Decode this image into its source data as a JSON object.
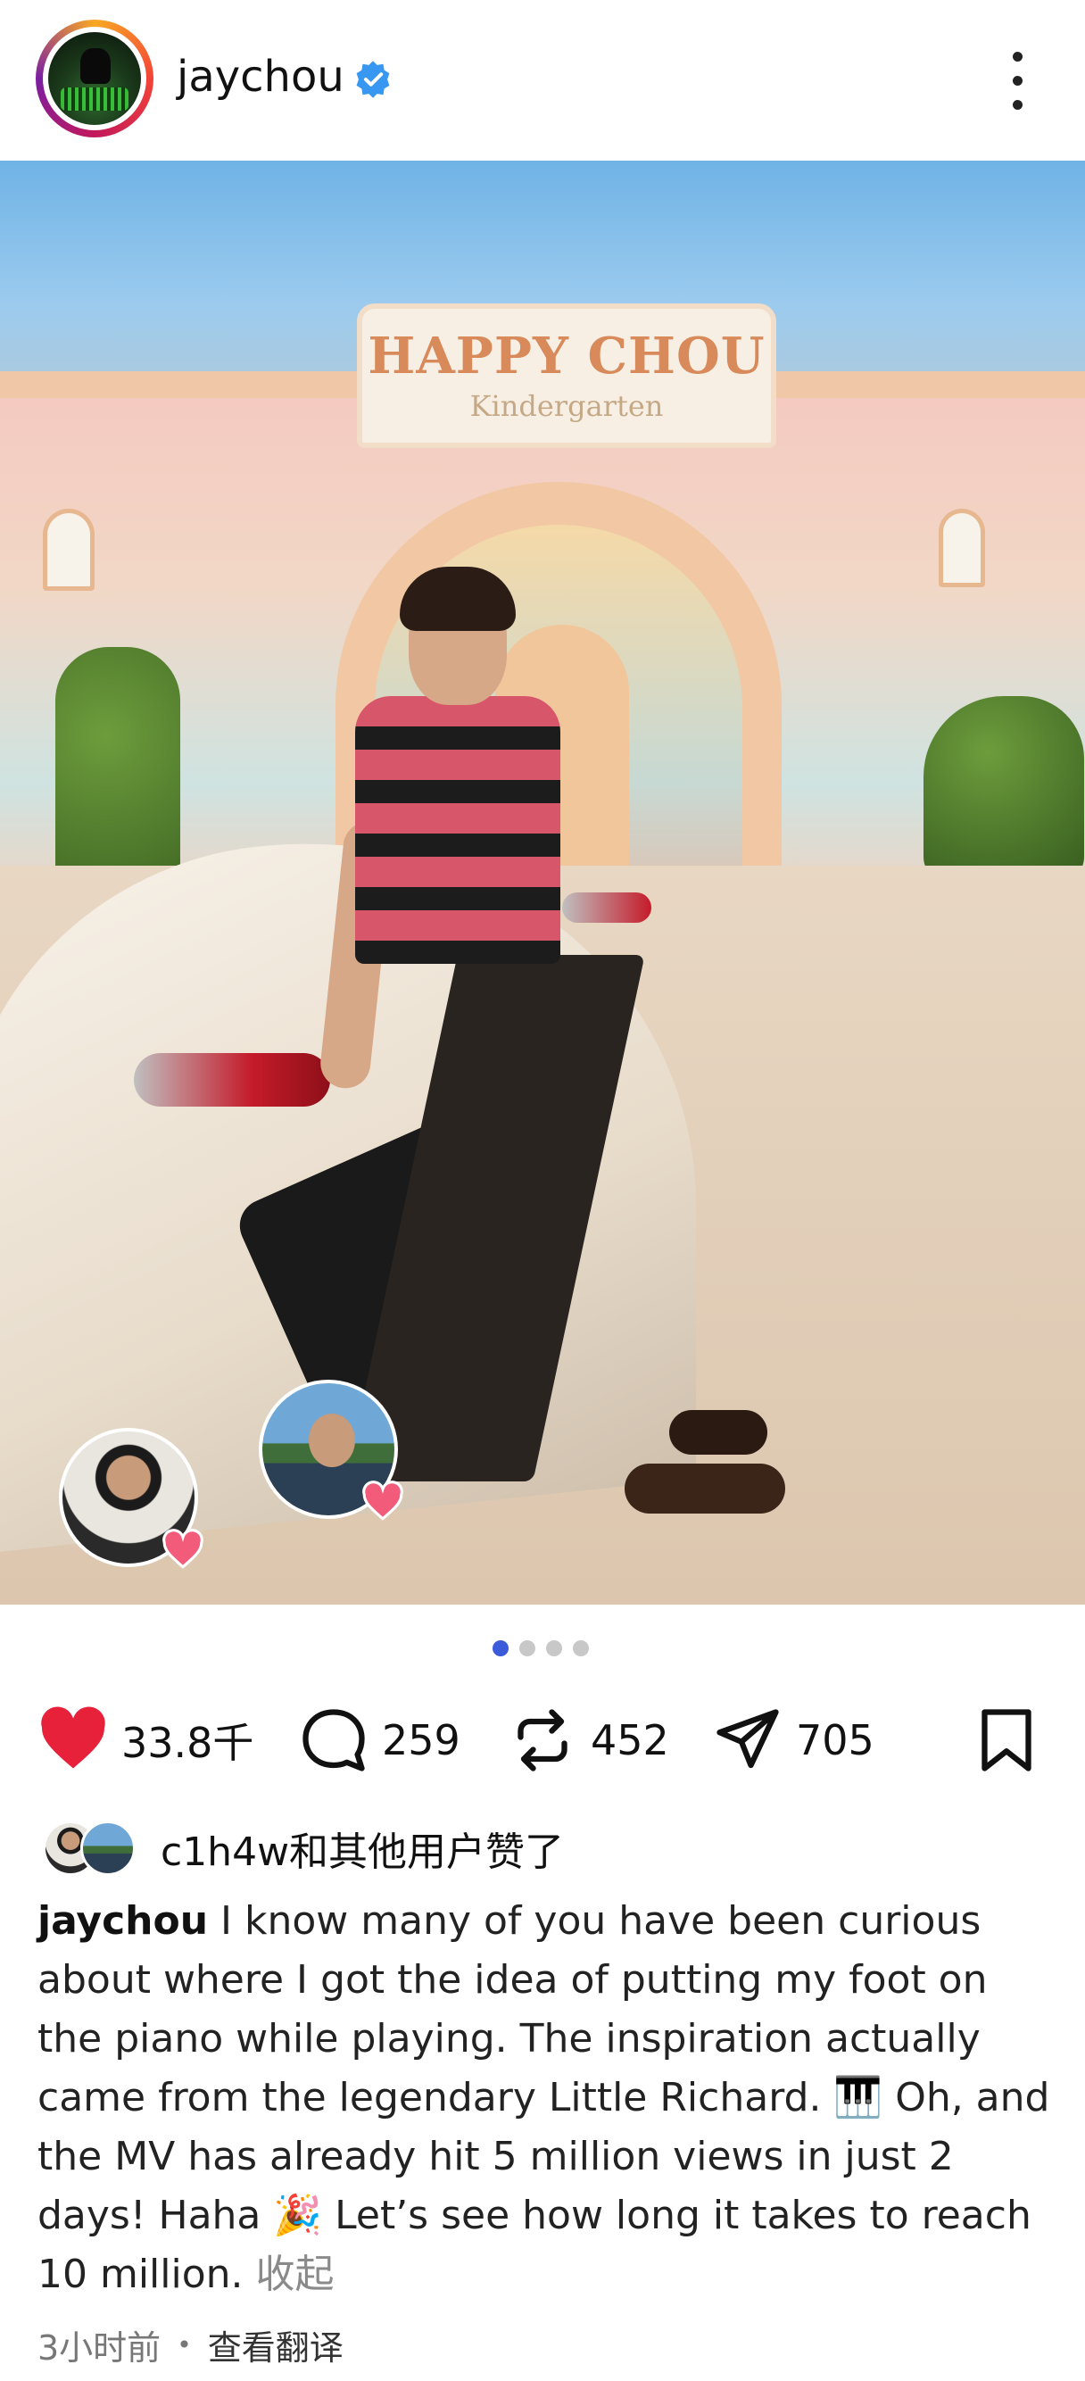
{
  "post": {
    "username": "jaychou",
    "verified": true,
    "photo_sign_line1": "HAPPY CHOU",
    "photo_sign_line2": "Kindergarten",
    "carousel": {
      "total": 4,
      "current": 1
    }
  },
  "actions": {
    "likes": "33.8千",
    "comments": "259",
    "reposts": "452",
    "shares": "705"
  },
  "liked_by_text": "c1h4w和其他用户赞了",
  "caption": {
    "username": "jaychou",
    "text": " I know many of you have been curious about where I got the idea of putting my foot on the piano while playing. The inspiration actually came from the legendary Little Richard. 🎹 Oh, and the MV has already hit 5 million views in just 2 days! Haha 🎉 Let’s see how long it takes to reach 10 million.",
    "collapse_label": " 收起"
  },
  "meta": {
    "time_ago": "3小时前",
    "separator": "•",
    "translate_label": "查看翻译"
  },
  "colors": {
    "heart": "#e8213b",
    "verified": "#3897f0",
    "dot_active": "#3b5bdb"
  }
}
